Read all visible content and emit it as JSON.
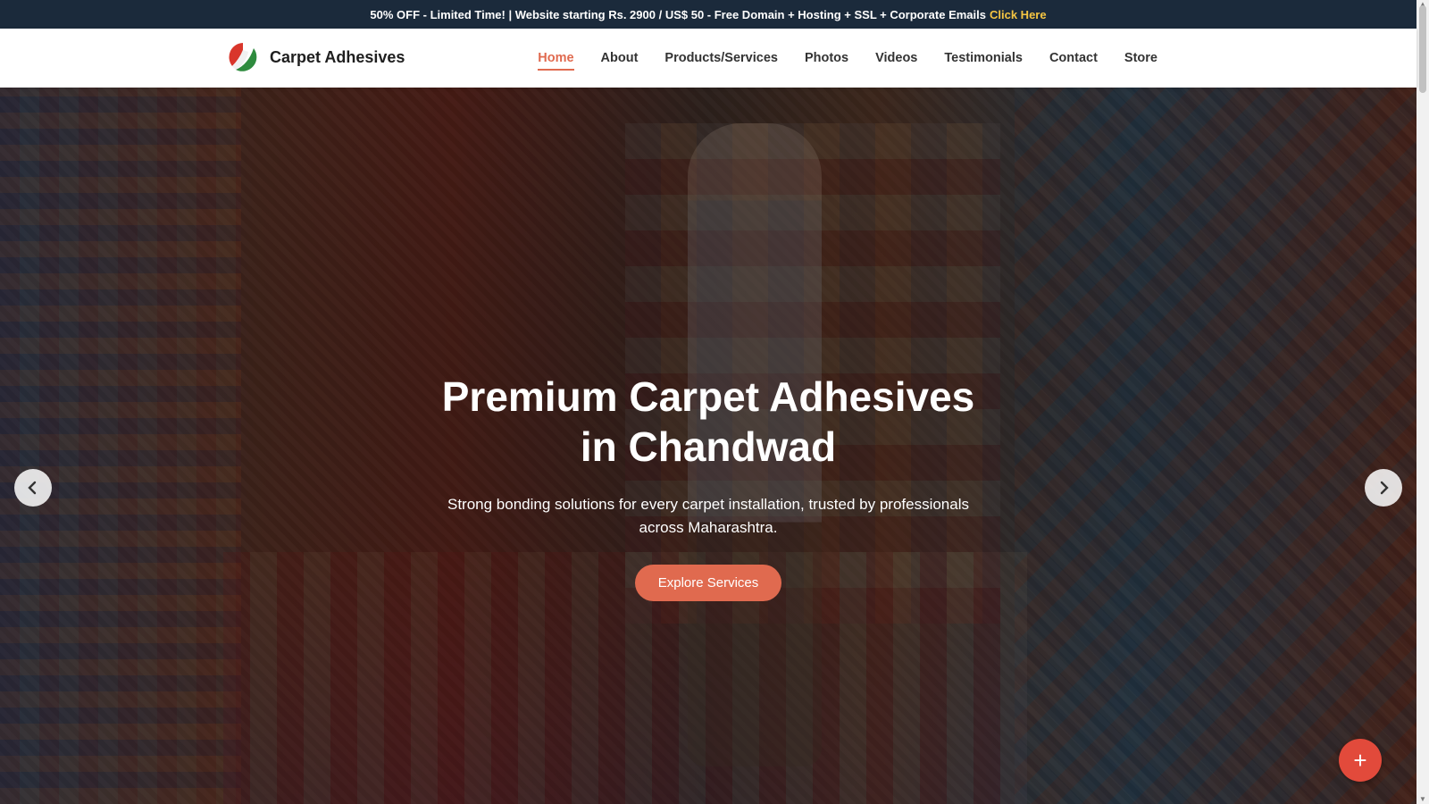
{
  "promo": {
    "text": "50% OFF - Limited Time! | Website starting Rs. 2900 / US$ 50 - Free Domain + Hosting + SSL + Corporate Emails",
    "link": "Click Here"
  },
  "brand": {
    "name": "Carpet Adhesives"
  },
  "nav": {
    "items": [
      {
        "label": "Home"
      },
      {
        "label": "About"
      },
      {
        "label": "Products/Services"
      },
      {
        "label": "Photos"
      },
      {
        "label": "Videos"
      },
      {
        "label": "Testimonials"
      },
      {
        "label": "Contact"
      },
      {
        "label": "Store"
      }
    ]
  },
  "hero": {
    "title": "Premium Carpet Adhesives in Chandwad",
    "subtitle": "Strong bonding solutions for every carpet installation, trusted by professionals across Maharashtra.",
    "cta": "Explore Services"
  },
  "fab": {
    "label": "+"
  },
  "colors": {
    "accent": "#e06a4f",
    "promo_bg": "#1b2a3b",
    "promo_link": "#f5c542"
  }
}
